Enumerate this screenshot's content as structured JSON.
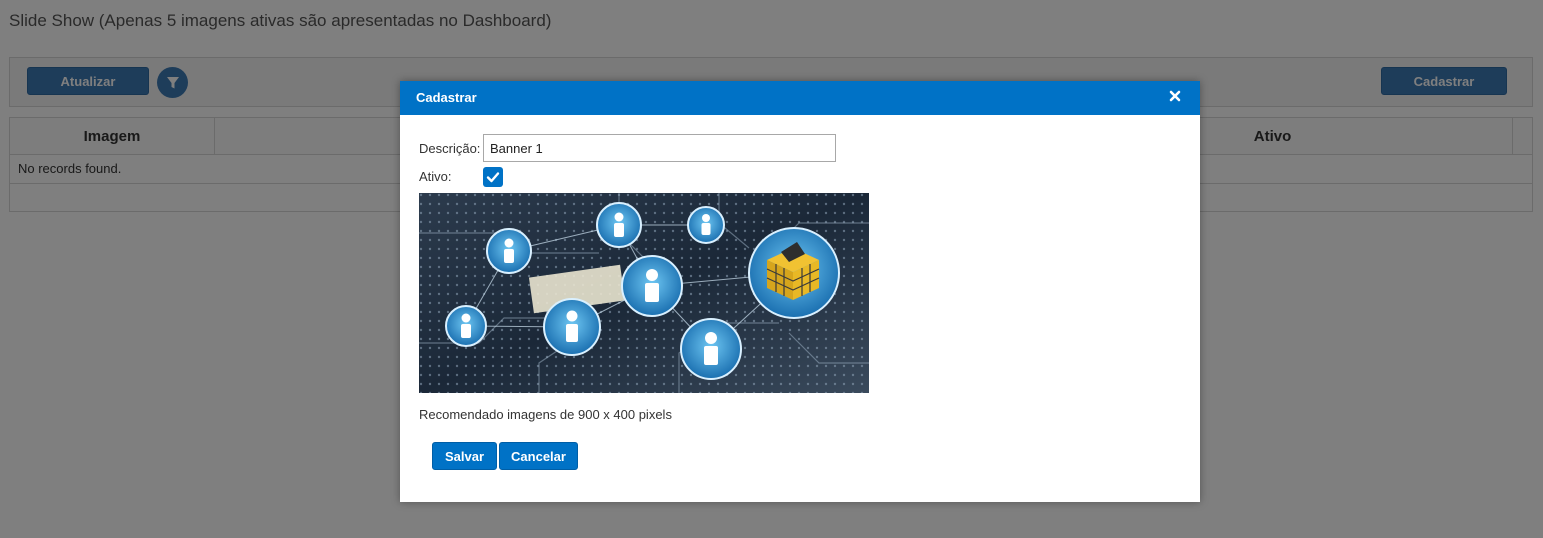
{
  "page": {
    "title": "Slide Show (Apenas 5 imagens ativas são apresentadas no Dashboard)",
    "toolbar": {
      "refresh_label": "Atualizar",
      "filter_icon": "filter-icon",
      "create_label": "Cadastrar"
    },
    "grid": {
      "columns": [
        "Imagem",
        "Ativo"
      ],
      "empty_message": "No records found."
    }
  },
  "dialog": {
    "title": "Cadastrar",
    "close_icon": "close-icon",
    "fields": {
      "description_label": "Descrição:",
      "description_value": "Banner 1",
      "active_label": "Ativo:",
      "active_checked": true
    },
    "image_hint": "Recomendado imagens de 900 x 400 pixels",
    "buttons": {
      "save_label": "Salvar",
      "cancel_label": "Cancelar"
    }
  },
  "colors": {
    "primary": "#0072c6",
    "overlay": "rgba(0,0,0,0.5)"
  }
}
